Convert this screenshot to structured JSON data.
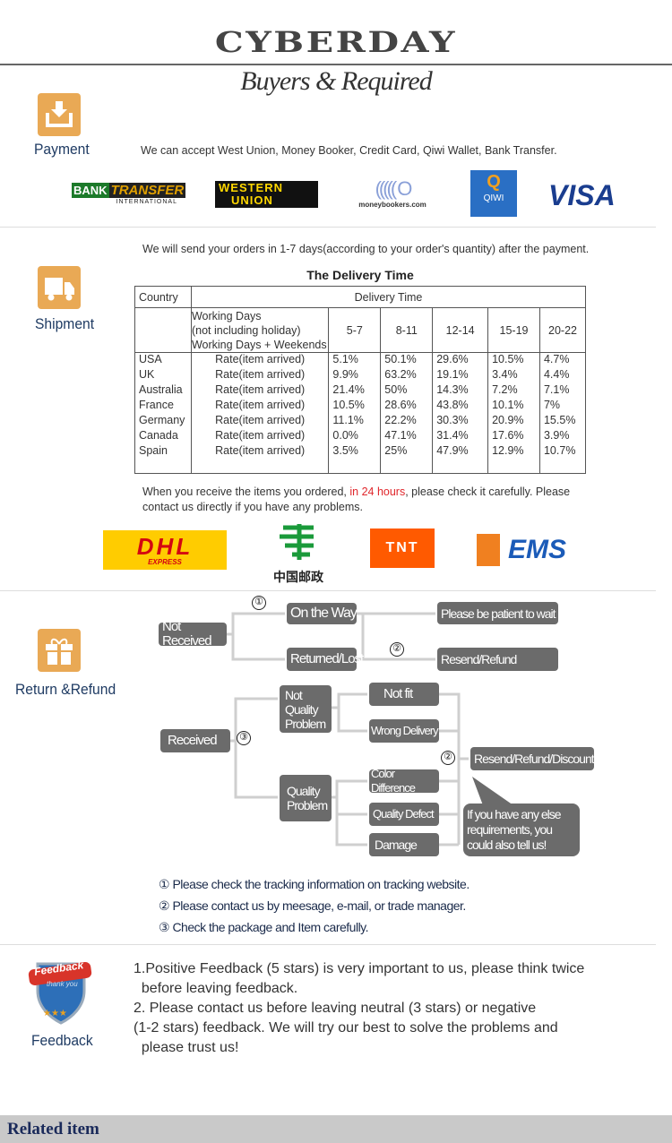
{
  "header": {
    "brand": "CYBERDAY",
    "subtitle": "Buyers & Required"
  },
  "payment": {
    "label": "Payment",
    "icon": "download-tray-icon",
    "text": "We can accept West Union, Money Booker, Credit Card, Qiwi Wallet, Bank Transfer.",
    "logos": {
      "bank_transfer": "BANK",
      "bank_transfer2": "TRANSFER",
      "bank_transfer3": "INTERNATIONAL",
      "western_union": "WESTERN",
      "western_union2": "UNION",
      "moneybookers": "moneybookers.com",
      "qiwi": "QIWI",
      "visa": "VISA"
    }
  },
  "shipment": {
    "label": "Shipment",
    "icon": "truck-icon",
    "text": "We will send your orders in 1-7 days(according to your order's quantity) after the payment.",
    "table_title": "The Delivery Time",
    "head1": [
      "Country",
      "Delivery Time"
    ],
    "head2": {
      "l1": "Working Days",
      "l2": "(not including holiday)",
      "l3": "Working Days + Weekends",
      "ranges": [
        "5-7",
        "8-11",
        "12-14",
        "15-19",
        "20-22"
      ]
    },
    "rows": [
      {
        "country": "USA",
        "label": "Rate(item arrived)",
        "values": [
          "5.1%",
          "50.1%",
          "29.6%",
          "10.5%",
          "4.7%"
        ]
      },
      {
        "country": "UK",
        "label": "Rate(item arrived)",
        "values": [
          "9.9%",
          "63.2%",
          "19.1%",
          "3.4%",
          "4.4%"
        ]
      },
      {
        "country": "Australia",
        "label": "Rate(item arrived)",
        "values": [
          "21.4%",
          "50%",
          "14.3%",
          "7.2%",
          "7.1%"
        ]
      },
      {
        "country": "France",
        "label": "Rate(item arrived)",
        "values": [
          "10.5%",
          "28.6%",
          "43.8%",
          "10.1%",
          "7%"
        ]
      },
      {
        "country": "Germany",
        "label": "Rate(item arrived)",
        "values": [
          "11.1%",
          "22.2%",
          "30.3%",
          "20.9%",
          "15.5%"
        ]
      },
      {
        "country": "Canada",
        "label": "Rate(item arrived)",
        "values": [
          "0.0%",
          "47.1%",
          "31.4%",
          "17.6%",
          "3.9%"
        ]
      },
      {
        "country": "Spain",
        "label": "Rate(item arrived)",
        "values": [
          "3.5%",
          "25%",
          "47.9%",
          "12.9%",
          "10.7%"
        ]
      }
    ],
    "note_a": "When you receive the items you ordered, ",
    "note_red": "in 24 hours",
    "note_b": ", please check it carefully. Please",
    "note_c": "contact us directly if you have any problems.",
    "carriers": {
      "dhl": "DHL",
      "dhl_sub": "EXPRESS",
      "chinapost": "中国邮政",
      "tnt": "TNT",
      "ems": "EMS"
    }
  },
  "refund": {
    "label": "Return &Refund",
    "icon": "gift-box-icon",
    "flow": {
      "not_received": "Not Received",
      "on_the_way": "On the Way",
      "returned_lost": "Returned/Lost",
      "wait": "Please be patient to wait",
      "resend_refund": "Resend/Refund",
      "received": "Received",
      "not_quality": "Not Quality Problem",
      "quality": "Quality Problem",
      "not_fit": "Not fit",
      "wrong_delivery": "Wrong Delivery",
      "color_diff": "Color Difference",
      "quality_defect": "Quality Defect",
      "damage": "Damage",
      "resend_refund_discount": "Resend/Refund/Discount",
      "bubble": "If you have any else requirements, you could also tell us!",
      "c1": "①",
      "c2": "②",
      "c3": "③"
    },
    "notes": [
      "① Please check the tracking information on tracking website.",
      "② Please contact us by meesage, e-mail, or trade manager.",
      "③ Check the package and Item carefully."
    ]
  },
  "feedback": {
    "label": "Feedback",
    "badge": "Feedback",
    "badge_sub": "thank you",
    "lines": [
      "1.Positive Feedback (5 stars) is very important to us, please think twice",
      "  before leaving feedback.",
      "2. Please contact us before leaving neutral (3 stars) or negative",
      "(1-2 stars) feedback. We will try our best to solve the problems and",
      "  please trust us!"
    ]
  },
  "footer": {
    "related": "Related item"
  },
  "colors": {
    "icon_orange": "#e9a955",
    "box_gray": "#6b6b6b",
    "label_navy": "#1f3b63",
    "red": "#e0262b"
  }
}
